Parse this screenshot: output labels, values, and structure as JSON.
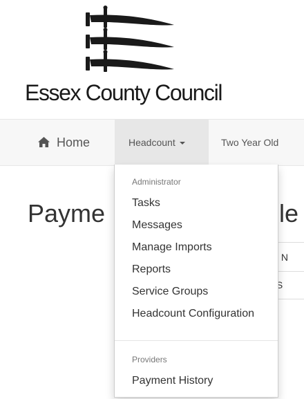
{
  "logo": {
    "text": "Essex County Council"
  },
  "nav": {
    "home": "Home",
    "headcount": "Headcount",
    "two_year_olds": "Two Year Old"
  },
  "page": {
    "title_start": "Payme",
    "title_tail": "le",
    "table_header_fragment": "y N",
    "table_row_fragment": ".S"
  },
  "dropdown": {
    "admin_header": "Administrator",
    "admin_items": [
      "Tasks",
      "Messages",
      "Manage Imports",
      "Reports",
      "Service Groups",
      "Headcount Configuration"
    ],
    "providers_header": "Providers",
    "provider_items": [
      "Payment History"
    ]
  },
  "colors": {
    "navbar_bg": "#f7f7f7",
    "active_tab_bg": "#e7e7e7",
    "dropdown_header": "#777777"
  }
}
